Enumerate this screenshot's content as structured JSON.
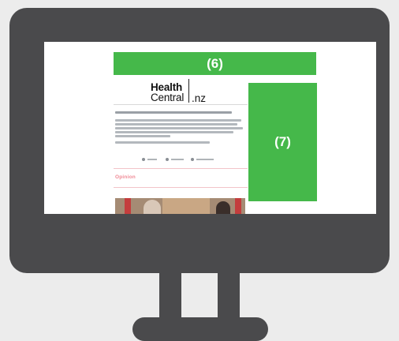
{
  "callouts": {
    "top_label": "(6)",
    "side_label": "(7)"
  },
  "site": {
    "logo_top": "Health",
    "logo_bottom": "Central",
    "logo_suffix": ".nz",
    "section_label": "Opinion"
  },
  "colors": {
    "monitor": "#4a4a4c",
    "callout_green": "#45b84a",
    "opinion_pink": "#f08a96",
    "background": "#ececec"
  },
  "icons": {
    "share_icons": [
      "share-icon",
      "facebook-icon",
      "email-icon"
    ]
  }
}
